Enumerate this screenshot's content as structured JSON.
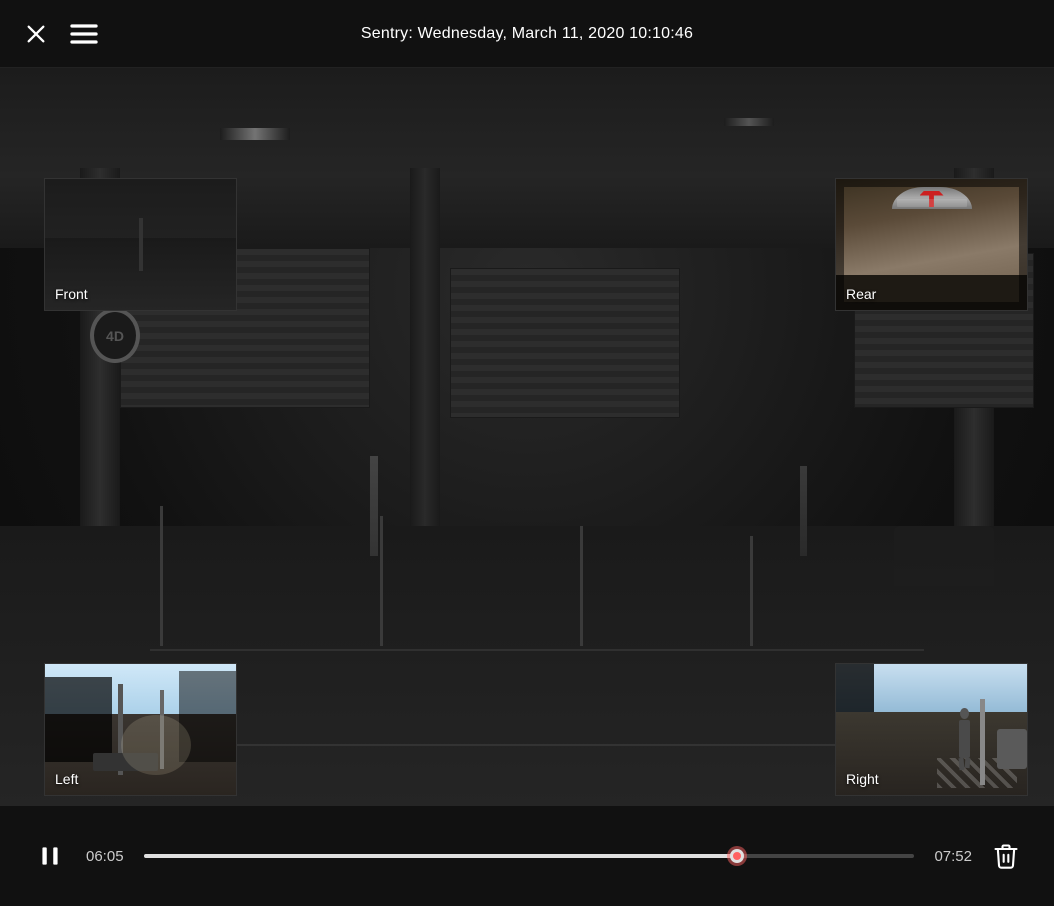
{
  "header": {
    "title": "Sentry: Wednesday, March 11, 2020 10:10:46",
    "close_label": "×",
    "menu_label": "≡"
  },
  "cameras": {
    "front": {
      "label": "Front"
    },
    "rear": {
      "label": "Rear"
    },
    "left": {
      "label": "Left"
    },
    "right": {
      "label": "Right"
    }
  },
  "controls": {
    "current_time": "06:05",
    "total_time": "07:52",
    "progress_percent": 77,
    "pause_icon": "pause",
    "delete_icon": "trash"
  },
  "icons": {
    "close": "✕",
    "menu": "☰",
    "pause": "⏸",
    "trash": "🗑"
  }
}
